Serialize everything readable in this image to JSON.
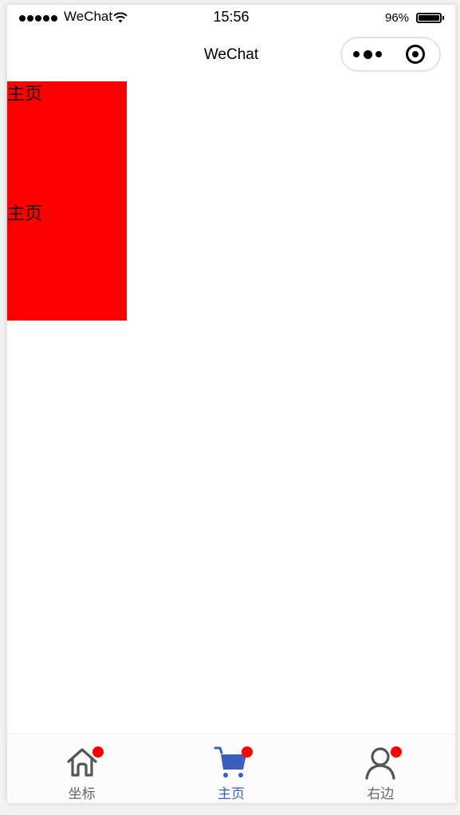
{
  "status_bar": {
    "carrier": "WeChat",
    "time": "15:56",
    "battery_percent": "96%",
    "signal_icon": "signal-dots-icon",
    "wifi_icon": "wifi-icon",
    "battery_icon": "battery-icon"
  },
  "nav_bar": {
    "title": "WeChat",
    "more_icon": "more-dots-icon",
    "close_icon": "target-circle-icon"
  },
  "content": {
    "block_color": "#ff0000",
    "items": [
      {
        "label": "主页"
      },
      {
        "label": "主页"
      }
    ]
  },
  "tab_bar": {
    "active_color": "#3c5fbf",
    "inactive_color": "#666666",
    "badge_color": "#ff0000",
    "tabs": [
      {
        "label": "坐标",
        "icon": "home-icon",
        "active": false,
        "badge": true
      },
      {
        "label": "主页",
        "icon": "cart-icon",
        "active": true,
        "badge": true
      },
      {
        "label": "右边",
        "icon": "user-icon",
        "active": false,
        "badge": true
      }
    ]
  }
}
